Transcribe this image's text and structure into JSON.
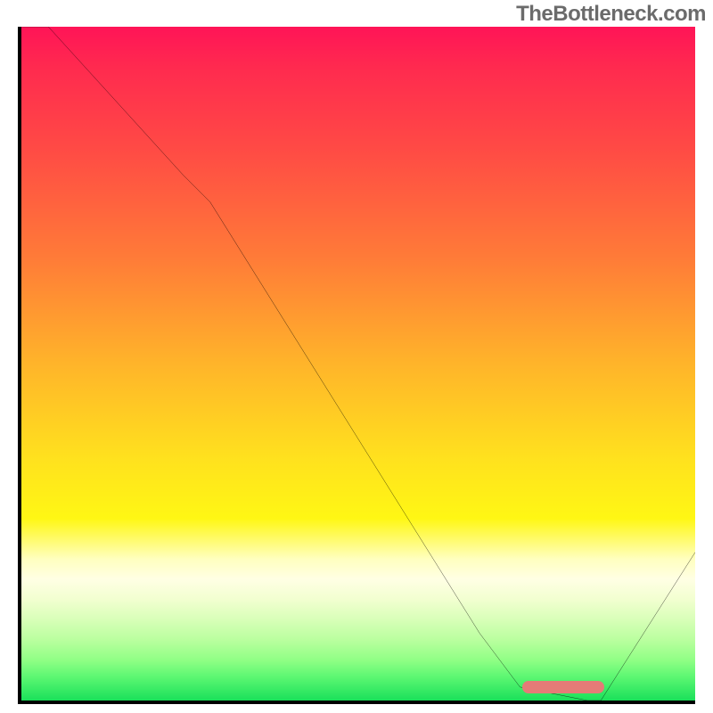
{
  "watermark": "TheBottleneck.com",
  "chart_data": {
    "type": "line",
    "title": "",
    "xlabel": "",
    "ylabel": "",
    "xlim": [
      0,
      100
    ],
    "ylim": [
      0,
      100
    ],
    "series": [
      {
        "name": "bottleneck-curve",
        "x": [
          0,
          4,
          24,
          28,
          68,
          74,
          84,
          86,
          100
        ],
        "values": [
          100,
          100,
          78,
          74,
          10,
          2,
          0,
          0,
          22
        ]
      }
    ],
    "annotations": [
      {
        "name": "optimal-range-marker",
        "x_start": 74,
        "x_end": 86,
        "y": 1,
        "color": "#e57b77"
      }
    ],
    "background": "rainbow-vertical-gradient"
  }
}
